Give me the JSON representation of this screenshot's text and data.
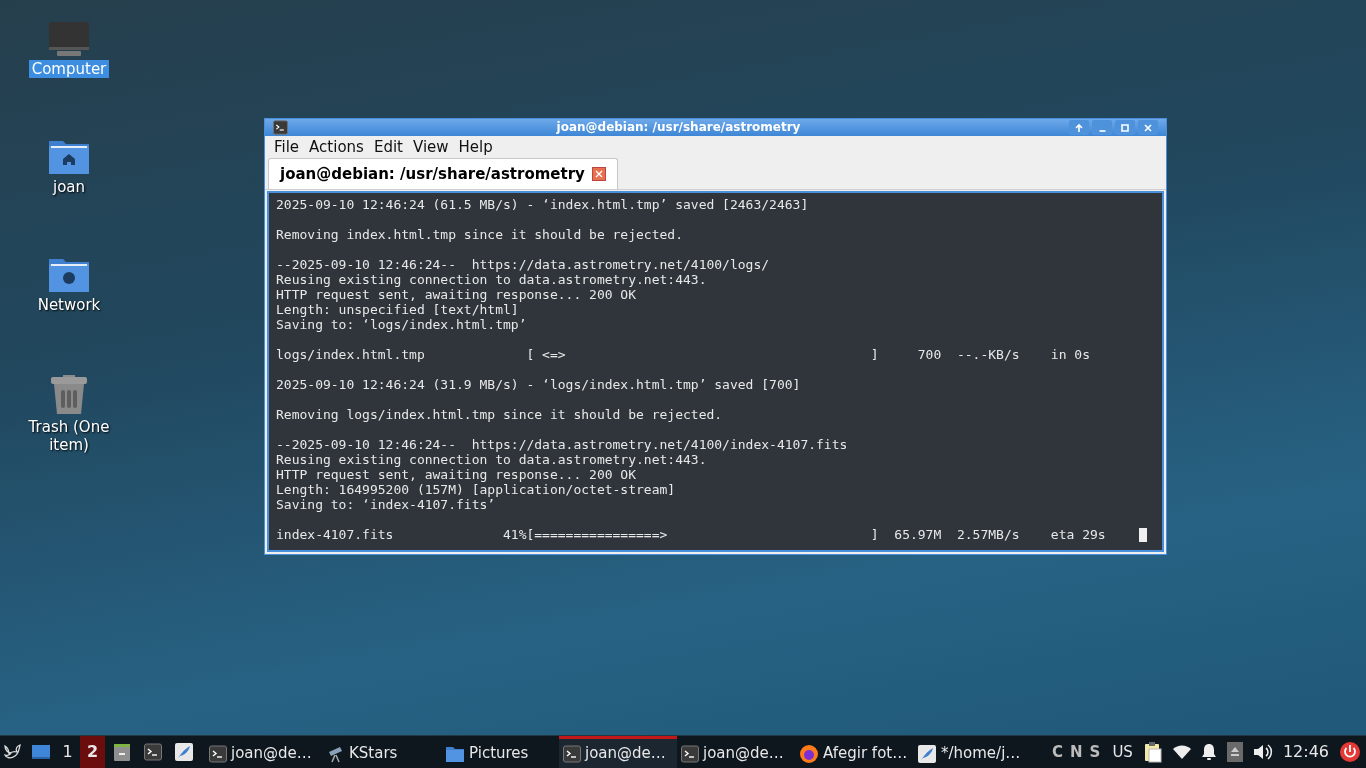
{
  "desktop_icons": [
    {
      "label": "Computer",
      "kind": "computer",
      "selected": true
    },
    {
      "label": "joan",
      "kind": "home",
      "selected": false
    },
    {
      "label": "Network",
      "kind": "network",
      "selected": false
    },
    {
      "label": "Trash (One item)",
      "kind": "trash",
      "selected": false
    }
  ],
  "window": {
    "title": "joan@debian: /usr/share/astrometry",
    "menu": [
      "File",
      "Actions",
      "Edit",
      "View",
      "Help"
    ],
    "tabs": [
      {
        "label": "joan@debian: /usr/share/astrometry",
        "selected": true
      }
    ],
    "terminal": [
      {
        "lines": [
          "2025-09-10 12:46:24 (61.5 MB/s) - ‘index.html.tmp’ saved [2463/2463]"
        ]
      },
      {
        "lines": [
          "Removing index.html.tmp since it should be rejected."
        ]
      },
      {
        "lines": [
          "--2025-09-10 12:46:24--  https://data.astrometry.net/4100/logs/",
          "Reusing existing connection to data.astrometry.net:443.",
          "HTTP request sent, awaiting response... 200 OK",
          "Length: unspecified [text/html]",
          "Saving to: ‘logs/index.html.tmp’"
        ]
      },
      {
        "lines": [
          "logs/index.html.tmp             [ <=>                                       ]     700  --.-KB/s    in 0s"
        ]
      },
      {
        "lines": [
          "2025-09-10 12:46:24 (31.9 MB/s) - ‘logs/index.html.tmp’ saved [700]"
        ]
      },
      {
        "lines": [
          "Removing logs/index.html.tmp since it should be rejected."
        ]
      },
      {
        "lines": [
          "--2025-09-10 12:46:24--  https://data.astrometry.net/4100/index-4107.fits",
          "Reusing existing connection to data.astrometry.net:443.",
          "HTTP request sent, awaiting response... 200 OK",
          "Length: 164995200 (157M) [application/octet-stream]",
          "Saving to: ‘index-4107.fits’"
        ]
      },
      {
        "lines": [
          "index-4107.fits              41%[================>                          ]  65.97M  2.57MB/s    eta 29s"
        ],
        "cursor": true
      }
    ]
  },
  "taskbar": {
    "workspaces": [
      {
        "label": "1",
        "selected": false
      },
      {
        "label": "2",
        "selected": true
      }
    ],
    "launchers": [
      {
        "kind": "files"
      },
      {
        "kind": "terminal"
      },
      {
        "kind": "editor"
      }
    ],
    "tasks": [
      {
        "label": "joan@de…",
        "kind": "terminal",
        "selected": false
      },
      {
        "label": "KStars",
        "kind": "telescope",
        "selected": false
      },
      {
        "label": "Pictures",
        "kind": "folder",
        "selected": false
      },
      {
        "label": "joan@de…",
        "kind": "terminal",
        "selected": true
      },
      {
        "label": "joan@de…",
        "kind": "terminal",
        "selected": false
      },
      {
        "label": "Afegir fot…",
        "kind": "browser",
        "selected": false
      },
      {
        "label": "*/home/j…",
        "kind": "editor",
        "selected": false
      }
    ],
    "lock_keys": [
      "C",
      "N",
      "S"
    ],
    "keyboard_layout": "US",
    "clock": "12:46"
  }
}
